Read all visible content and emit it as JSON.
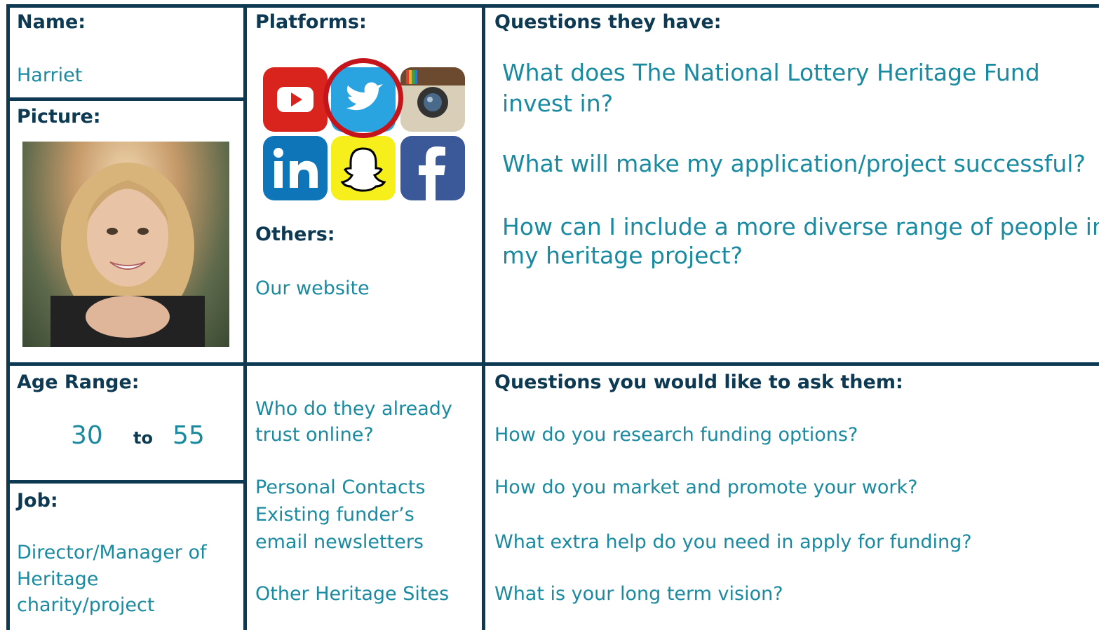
{
  "name": {
    "label": "Name:",
    "value": "Harriet"
  },
  "picture": {
    "label": "Picture:"
  },
  "platforms": {
    "label": "Platforms:",
    "icons": [
      "youtube-icon",
      "twitter-icon",
      "instagram-icon",
      "linkedin-icon",
      "snapchat-icon",
      "facebook-icon"
    ],
    "highlighted": "twitter-icon"
  },
  "others": {
    "label": "Others:",
    "value": "Our website"
  },
  "questions_they_have": {
    "label": "Questions they have:",
    "items": [
      {
        "line1": "What does The National Lottery Heritage Fund",
        "line2": "invest in?"
      },
      {
        "line1": "What will make my application/project successful?"
      },
      {
        "line1": "How can I include a more diverse range of people in",
        "line2": "my heritage project?"
      }
    ]
  },
  "age_range": {
    "label": "Age Range:",
    "min": "30",
    "to": "to",
    "max": "55"
  },
  "job": {
    "label": "Job:",
    "line1": "Director/Manager of",
    "line2": "Heritage",
    "line3": "charity/project"
  },
  "trust": {
    "q_line1": "Who do they already",
    "q_line2": "trust online?",
    "a1": "Personal Contacts",
    "a2_line1": "Existing funder’s",
    "a2_line2": "email newsletters",
    "a3": "Other Heritage Sites"
  },
  "questions_to_ask": {
    "label": "Questions you would like to ask them:",
    "items": [
      "How do you research funding options?",
      "How do you market and promote your work?",
      "What extra help do you need in apply for funding?",
      "What is your long term vision?"
    ]
  },
  "colors": {
    "border": "#0d3a52",
    "text": "#1a8aa0",
    "highlight_ring": "#c4141c"
  }
}
